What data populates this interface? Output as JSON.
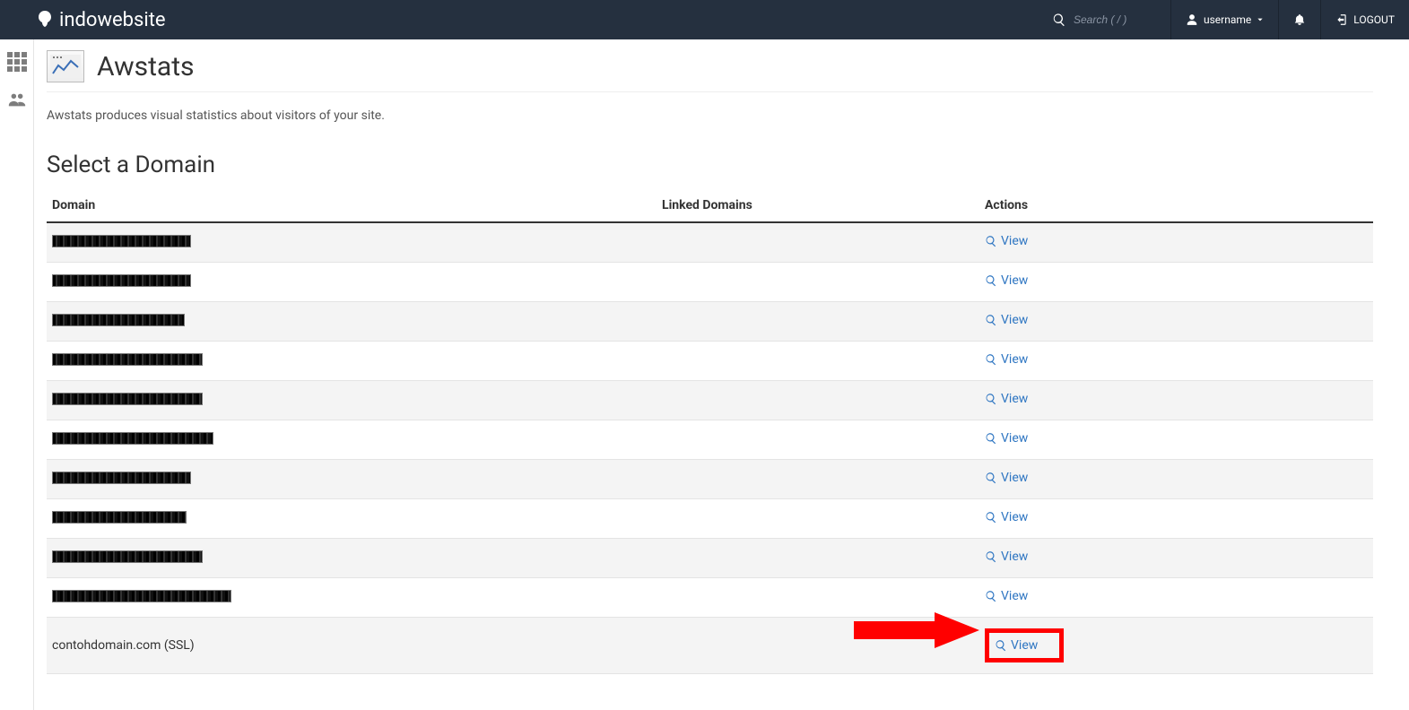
{
  "brand": "indowebsite",
  "header": {
    "search_placeholder": "Search ( / )",
    "username": "username",
    "logout": "LOGOUT"
  },
  "page": {
    "title": "Awstats",
    "description": "Awstats produces visual statistics about visitors of your site.",
    "section_title": "Select a Domain"
  },
  "table": {
    "col_domain": "Domain",
    "col_linked": "Linked Domains",
    "col_actions": "Actions",
    "view_label": "View",
    "rows": [
      {
        "domain": "",
        "redacted": true,
        "redacted_width": 155
      },
      {
        "domain": "",
        "redacted": true,
        "redacted_width": 155
      },
      {
        "domain": "",
        "redacted": true,
        "redacted_width": 148
      },
      {
        "domain": "",
        "redacted": true,
        "redacted_width": 168
      },
      {
        "domain": "",
        "redacted": true,
        "redacted_width": 168
      },
      {
        "domain": "",
        "redacted": true,
        "redacted_width": 180
      },
      {
        "domain": "",
        "redacted": true,
        "redacted_width": 155
      },
      {
        "domain": "",
        "redacted": true,
        "redacted_width": 150
      },
      {
        "domain": "",
        "redacted": true,
        "redacted_width": 168
      },
      {
        "domain": "",
        "redacted": true,
        "redacted_width": 200
      },
      {
        "domain": "contohdomain.com (SSL)",
        "redacted": false,
        "highlight": true
      }
    ]
  }
}
